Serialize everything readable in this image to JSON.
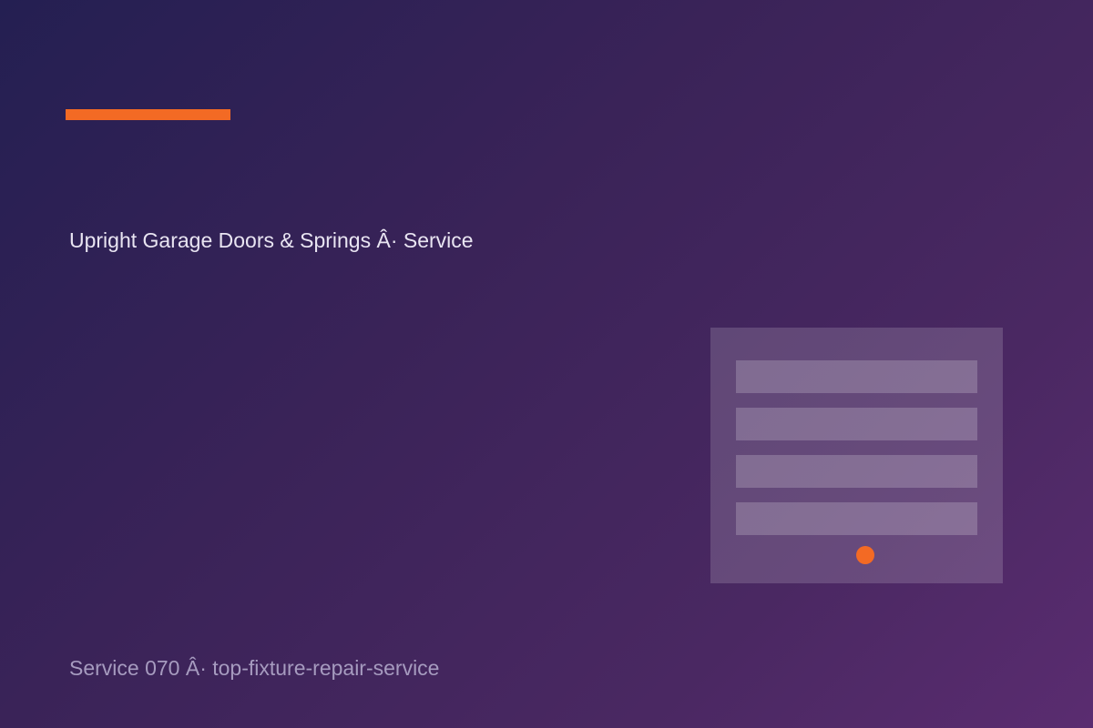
{
  "headline": "Upright Garage Doors & Springs Â· Service",
  "footer": "Service 070 Â· top-fixture-repair-service",
  "colors": {
    "accent": "#f36a24",
    "background_start": "#241f52",
    "background_end": "#5a2c70"
  },
  "illustration": {
    "icon": "garage-door-icon"
  }
}
